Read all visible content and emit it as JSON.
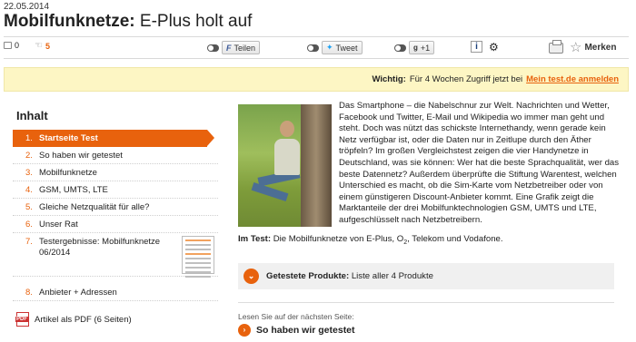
{
  "article": {
    "date": "22.05.2014",
    "title_bold": "Mobilfunknetze:",
    "title_rest": "E-Plus holt auf"
  },
  "toolbar": {
    "comments_count": "0",
    "likes_count": "5",
    "facebook_label": "Teilen",
    "twitter_label": "Tweet",
    "gplus_label": "+1",
    "merken_label": "Merken",
    "icons": [
      "comment-icon",
      "like-icon",
      "toggle-icon",
      "facebook-icon",
      "twitter-icon",
      "gplus-icon",
      "info-icon",
      "gear-icon",
      "printer-icon",
      "star-icon"
    ]
  },
  "banner": {
    "prefix": "Wichtig:",
    "text": "Für 4 Wochen Zugriff jetzt bei",
    "link": "Mein test.de anmelden"
  },
  "toc": {
    "heading": "Inhalt",
    "items": [
      {
        "num": "1.",
        "label": "Startseite Test"
      },
      {
        "num": "2.",
        "label": "So haben wir getestet"
      },
      {
        "num": "3.",
        "label": "Mobilfunknetze"
      },
      {
        "num": "4.",
        "label": "GSM, UMTS, LTE"
      },
      {
        "num": "5.",
        "label": "Gleiche Netzqualität für alle?"
      },
      {
        "num": "6.",
        "label": "Unser Rat"
      },
      {
        "num": "7.",
        "label": "Testergebnisse: Mobilfunknetze 06/2014"
      },
      {
        "num": "8.",
        "label": "Anbieter + Adressen"
      }
    ],
    "pdf_label": "Artikel als PDF (6 Seiten)"
  },
  "content": {
    "intro": "Das Smartphone – die Nabelschnur zur Welt. Nachrichten und Wetter, Facebook und Twitter, E-Mail und Wikipedia wo immer man geht und steht. Doch was nützt das schickste Internethandy, wenn gerade kein Netz verfügbar ist, oder die Daten nur in Zeitlupe durch den Äther tröpfeln? Im großen Vergleichstest zeigen die vier Handynetze in Deutschland, was sie können: Wer hat die beste Sprachqualität, wer das beste Datennetz? Außerdem überprüfte die Stiftung Warentest, welchen Unterschied es macht, ob die Sim-Karte vom Netzbetreiber oder von einem günstigeren Discount-Anbieter kommt. Eine Grafik zeigt die Marktanteile der drei Mobilfunktechnologien GSM, UMTS und LTE, aufgeschlüsselt nach Netzbetreibern.",
    "im_test_label": "Im Test:",
    "im_test_pre": "Die Mobilfunknetze von E-Plus, O",
    "im_test_sub": "2",
    "im_test_post": ", Telekom und Vodafone."
  },
  "products": {
    "label": "Getestete Produkte:",
    "text": "Liste aller 4 Produkte"
  },
  "next_page": {
    "label": "Lesen Sie auf der nächsten Seite:",
    "link": "So haben wir getestet"
  }
}
